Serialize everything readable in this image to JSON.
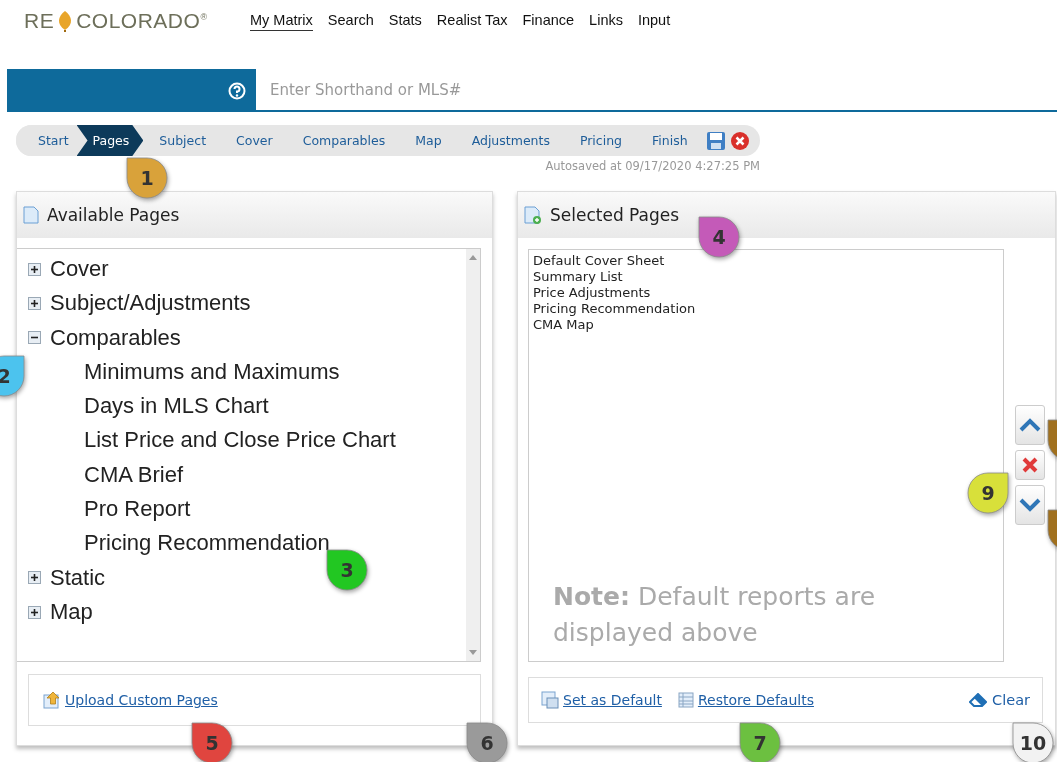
{
  "logo": {
    "left": "RE",
    "right": "COLORADO",
    "mark": "®"
  },
  "nav": [
    {
      "label": "My Matrix",
      "selected": true
    },
    {
      "label": "Search",
      "selected": false
    },
    {
      "label": "Stats",
      "selected": false
    },
    {
      "label": "Realist Tax",
      "selected": false
    },
    {
      "label": "Finance",
      "selected": false
    },
    {
      "label": "Links",
      "selected": false
    },
    {
      "label": "Input",
      "selected": false
    }
  ],
  "search": {
    "placeholder": "Enter Shorthand or MLS#"
  },
  "steps": [
    {
      "label": "Start",
      "selected": false
    },
    {
      "label": "Pages",
      "selected": true
    },
    {
      "label": "Subject",
      "selected": false
    },
    {
      "label": "Cover",
      "selected": false
    },
    {
      "label": "Comparables",
      "selected": false
    },
    {
      "label": "Map",
      "selected": false
    },
    {
      "label": "Adjustments",
      "selected": false
    },
    {
      "label": "Pricing",
      "selected": false
    },
    {
      "label": "Finish",
      "selected": false
    }
  ],
  "autosave": "Autosaved at 09/17/2020 4:27:25 PM",
  "available": {
    "title": "Available Pages",
    "tree": [
      {
        "label": "Cover",
        "expanded": false
      },
      {
        "label": "Subject/Adjustments",
        "expanded": false
      },
      {
        "label": "Comparables",
        "expanded": true,
        "children": [
          {
            "label": "Minimums and Maximums"
          },
          {
            "label": "Days in MLS Chart"
          },
          {
            "label": "List Price and Close Price Chart"
          },
          {
            "label": "CMA Brief"
          },
          {
            "label": "Pro Report"
          },
          {
            "label": "Pricing Recommendation"
          }
        ]
      },
      {
        "label": "Static",
        "expanded": false
      },
      {
        "label": "Map",
        "expanded": false
      }
    ],
    "upload": "Upload Custom Pages"
  },
  "selected": {
    "title": "Selected Pages",
    "items": [
      "Default Cover Sheet",
      "Summary List",
      "Price Adjustments",
      "Pricing Recommendation",
      "CMA Map"
    ],
    "note": "**Note:** Default reports are displayed above",
    "set_default": "Set as Default",
    "restore": "Restore Defaults",
    "clear": "Clear"
  },
  "callouts": [
    {
      "label": "1",
      "color": "#d9a23a"
    },
    {
      "label": "2",
      "color": "#4cc3ee"
    },
    {
      "label": "3",
      "color": "#22c722"
    },
    {
      "label": "4",
      "color": "#c45ab8"
    },
    {
      "label": "5",
      "color": "#e0453f"
    },
    {
      "label": "6",
      "color": "#9a9a9a"
    },
    {
      "label": "7",
      "color": "#6cc040"
    },
    {
      "label": "9",
      "color": "#d8e03a"
    },
    {
      "label": "10",
      "color": "#f2f2f2"
    },
    {
      "color": "#a0701e"
    },
    {
      "color": "#a0701e"
    }
  ]
}
